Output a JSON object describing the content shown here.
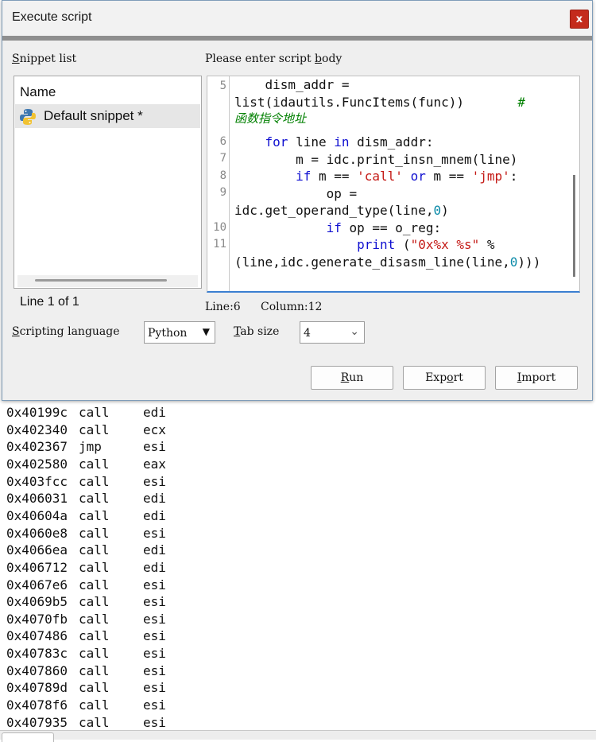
{
  "dialog": {
    "title": "Execute script",
    "close_glyph": "x",
    "snippet_list_label_first": "S",
    "snippet_list_label_rest": "nippet list",
    "script_body_label_pre": "Please enter script ",
    "script_body_label_ul": "b",
    "script_body_label_post": "ody"
  },
  "snippets": {
    "column_header": "Name",
    "items": [
      {
        "label": "Default snippet *",
        "icon": "python-icon"
      }
    ],
    "line_info": "Line 1 of 1"
  },
  "editor": {
    "line_numbers": [
      "5",
      "6",
      "7",
      "8",
      "9",
      "10",
      "11"
    ],
    "status_line": "Line:6",
    "status_column": "Column:12",
    "code": {
      "l5a": "    dism_addr =",
      "l5b_text": "list(idautils.FuncItems(func))",
      "l5b_pad": "       ",
      "l5b_comment_hash": "#",
      "l5c_comment": "函数指令地址",
      "l6_indent": "    ",
      "l6_for": "for",
      "l6_mid": " line ",
      "l6_in": "in",
      "l6_rest": " dism_addr:",
      "l7": "        m = idc.print_insn_mnem(line)",
      "l8_indent": "        ",
      "l8_if": "if",
      "l8_a": " m == ",
      "l8_call": "'call'",
      "l8_sp": " ",
      "l8_or": "or",
      "l8_b": " m == ",
      "l8_jmp": "'jmp'",
      "l8_colon": ":",
      "l9a": "            op =",
      "l9b_text": "idc.get_operand_type(line,",
      "l9b_num": "0",
      "l9b_close": ")",
      "l10_indent": "            ",
      "l10_if": "if",
      "l10_rest": " op == o_reg:",
      "l11_indent": "                ",
      "l11_print": "print",
      "l11_sp": " (",
      "l11_fmt": "\"0x%x %s\"",
      "l11_pct": " %",
      "l11b_text": "(line,idc.generate_disasm_line(line,",
      "l11b_num": "0",
      "l11b_close": ")))"
    }
  },
  "controls": {
    "scripting_language_label_ul": "S",
    "scripting_language_label_rest": "cripting language",
    "scripting_language_value": "Python",
    "tab_size_label_ul": "T",
    "tab_size_label_rest": "ab size",
    "tab_size_value": "4"
  },
  "buttons": {
    "run_ul": "R",
    "run_rest": "un",
    "export_pre": "Exp",
    "export_ul": "o",
    "export_rest": "rt",
    "import_ul": "I",
    "import_rest": "mport"
  },
  "output_lines": [
    {
      "addr": "0x40199c",
      "mnem": "call",
      "reg": "edi"
    },
    {
      "addr": "0x402340",
      "mnem": "call",
      "reg": "ecx"
    },
    {
      "addr": "0x402367",
      "mnem": "jmp",
      "reg": "esi"
    },
    {
      "addr": "0x402580",
      "mnem": "call",
      "reg": "eax"
    },
    {
      "addr": "0x403fcc",
      "mnem": "call",
      "reg": "esi"
    },
    {
      "addr": "0x406031",
      "mnem": "call",
      "reg": "edi"
    },
    {
      "addr": "0x40604a",
      "mnem": "call",
      "reg": "edi"
    },
    {
      "addr": "0x4060e8",
      "mnem": "call",
      "reg": "esi"
    },
    {
      "addr": "0x4066ea",
      "mnem": "call",
      "reg": "edi"
    },
    {
      "addr": "0x406712",
      "mnem": "call",
      "reg": "edi"
    },
    {
      "addr": "0x4067e6",
      "mnem": "call",
      "reg": "esi"
    },
    {
      "addr": "0x4069b5",
      "mnem": "call",
      "reg": "esi"
    },
    {
      "addr": "0x4070fb",
      "mnem": "call",
      "reg": "esi"
    },
    {
      "addr": "0x407486",
      "mnem": "call",
      "reg": "esi"
    },
    {
      "addr": "0x40783c",
      "mnem": "call",
      "reg": "esi"
    },
    {
      "addr": "0x407860",
      "mnem": "call",
      "reg": "esi"
    },
    {
      "addr": "0x40789d",
      "mnem": "call",
      "reg": "esi"
    },
    {
      "addr": "0x4078f6",
      "mnem": "call",
      "reg": "esi"
    },
    {
      "addr": "0x407935",
      "mnem": "call",
      "reg": "esi"
    }
  ],
  "colors": {
    "close_button": "#c42b1c",
    "keyword": "#1010d0",
    "string": "#c41a16",
    "number": "#0a8aa8",
    "comment": "#008000",
    "editor_focus_border": "#3b7fd1"
  }
}
